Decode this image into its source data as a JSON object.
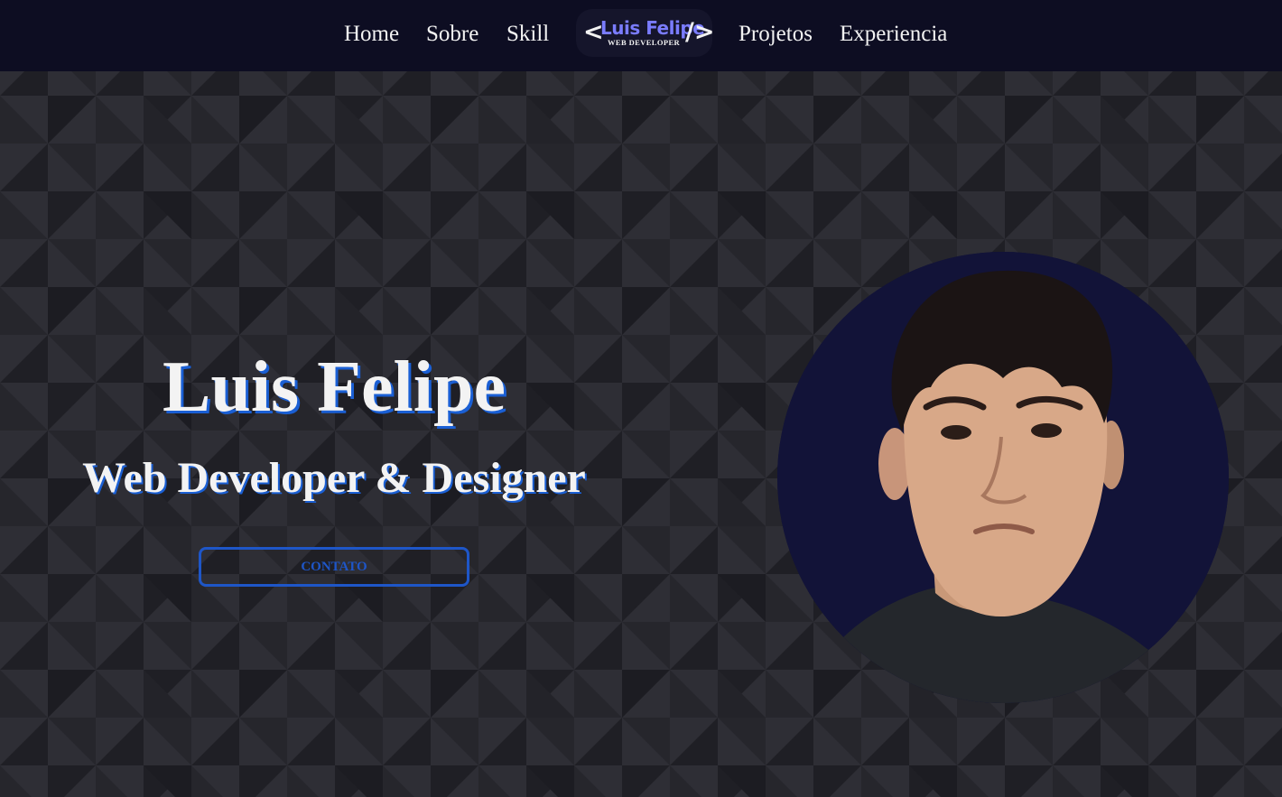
{
  "nav": {
    "items": [
      "Home",
      "Sobre",
      "Skill",
      "Projetos",
      "Experiencia"
    ],
    "logo": {
      "name": "Luis Felipe",
      "subtitle": "WEB DEVELOPER",
      "open": "<",
      "close": "/>"
    }
  },
  "hero": {
    "name": "Luis Felipe",
    "role": "Web Developer & Designer",
    "cta_label": "CONTATO"
  },
  "portrait": {
    "alt": "profile photo"
  },
  "colors": {
    "nav_bg": "#0d0d22",
    "accent": "#1e56c8",
    "logo_accent": "#7a7cff",
    "portrait_bg": "#121338",
    "pattern_light": "#2e2e35",
    "pattern_dark": "#1f1f25"
  }
}
